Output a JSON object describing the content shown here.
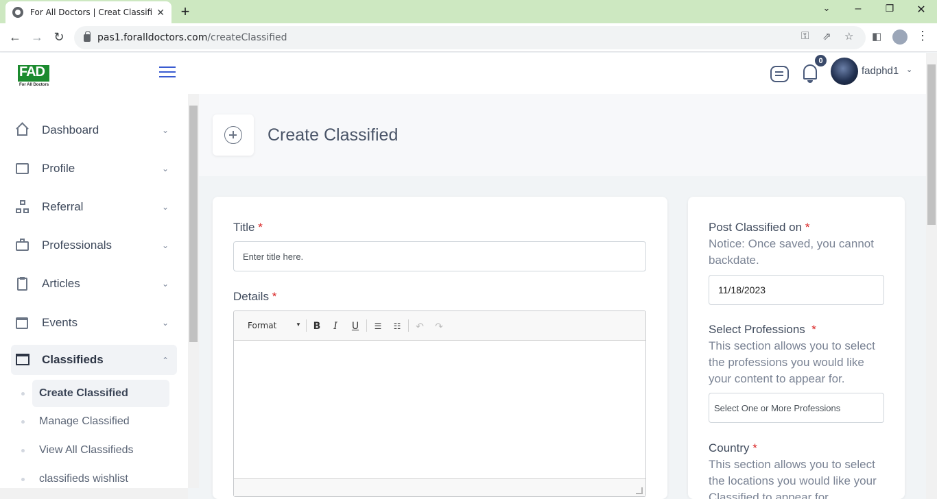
{
  "browser": {
    "tab_title": "For All Doctors | Creat Classified",
    "url_host": "pas1.foralldoctors.com",
    "url_path": "/createClassified"
  },
  "header": {
    "logo_text": "FAD",
    "logo_tagline": "For All Doctors",
    "notification_count": "0",
    "username": "fadphd1"
  },
  "sidebar": {
    "items": [
      {
        "label": "Dashboard"
      },
      {
        "label": "Profile"
      },
      {
        "label": "Referral"
      },
      {
        "label": "Professionals"
      },
      {
        "label": "Articles"
      },
      {
        "label": "Events"
      },
      {
        "label": "Classifieds"
      }
    ],
    "sub_items": [
      {
        "label": "Create Classified"
      },
      {
        "label": "Manage Classified"
      },
      {
        "label": "View All Classifieds"
      },
      {
        "label": "classifieds wishlist"
      }
    ]
  },
  "page": {
    "title": "Create Classified"
  },
  "form": {
    "title_label": "Title",
    "title_placeholder": "Enter title here.",
    "details_label": "Details",
    "editor_format": "Format",
    "required_mark": "*"
  },
  "side_form": {
    "post_on_label": "Post Classified on",
    "post_on_notice": "Notice: Once saved, you cannot backdate.",
    "post_on_value": "11/18/2023",
    "professions_label": "Select Professions",
    "professions_notice": "This section allows you to select the professions you would like your content to appear for.",
    "professions_placeholder": "Select One or More Professions",
    "country_label": "Country",
    "country_notice": "This section allows you to select the locations you would like your Classified to appear for."
  },
  "colors": {
    "accent": "#3a5bd0",
    "required": "#d92525",
    "tab_strip": "#cde8c1"
  }
}
